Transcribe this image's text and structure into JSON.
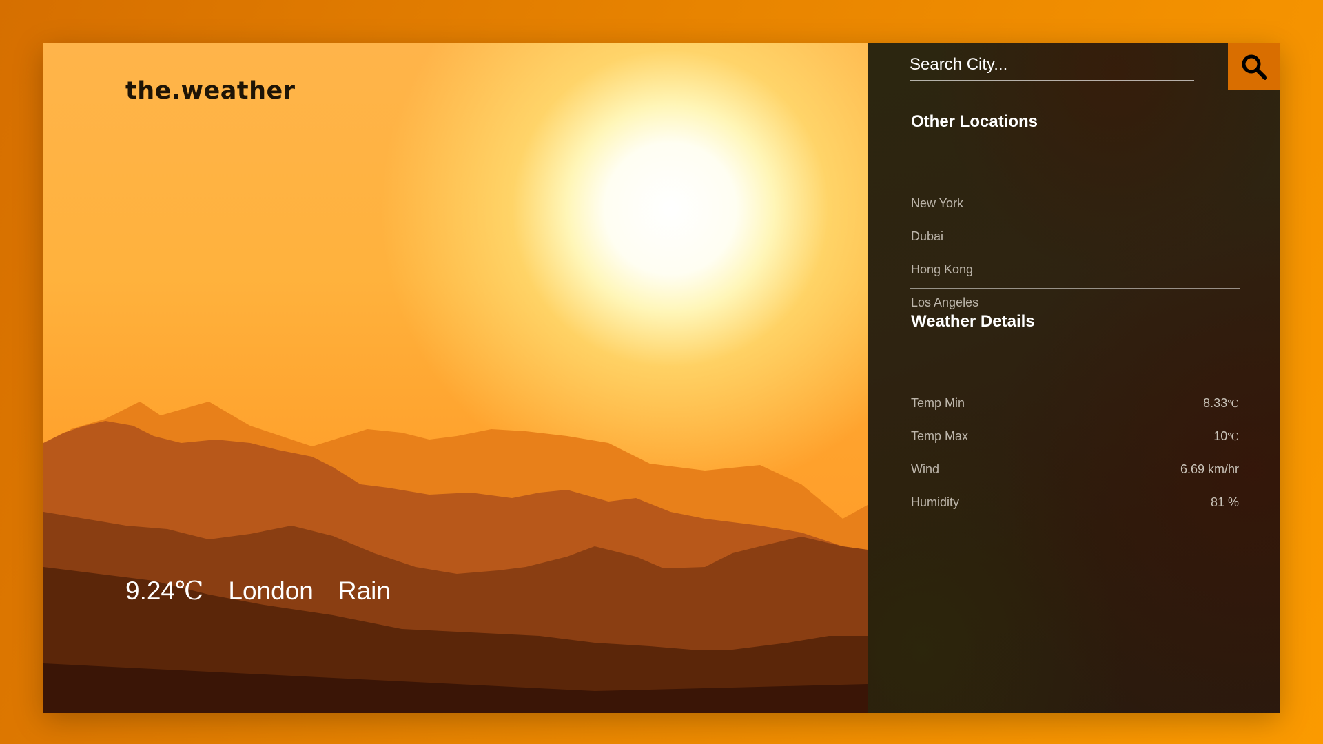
{
  "brand": "the.weather",
  "current": {
    "temperature": "9.24",
    "temp_unit": "℃",
    "city": "London",
    "condition": "Rain"
  },
  "search": {
    "placeholder": "Search City...",
    "button_icon": "search-icon"
  },
  "other_locations": {
    "title": "Other Locations",
    "items": [
      "New York",
      "Dubai",
      "Hong Kong",
      "Los Angeles"
    ]
  },
  "weather_details": {
    "title": "Weather Details",
    "rows": [
      {
        "label": "Temp Min",
        "value": "8.33",
        "unit": "℃"
      },
      {
        "label": "Temp Max",
        "value": "10",
        "unit": "℃"
      },
      {
        "label": "Wind",
        "value": "6.69 km/hr",
        "unit": ""
      },
      {
        "label": "Humidity",
        "value": "81 %",
        "unit": ""
      }
    ]
  },
  "colors": {
    "accent": "#d96e00",
    "panel_bg": "#2c2310",
    "page_bg": "#e88400"
  }
}
